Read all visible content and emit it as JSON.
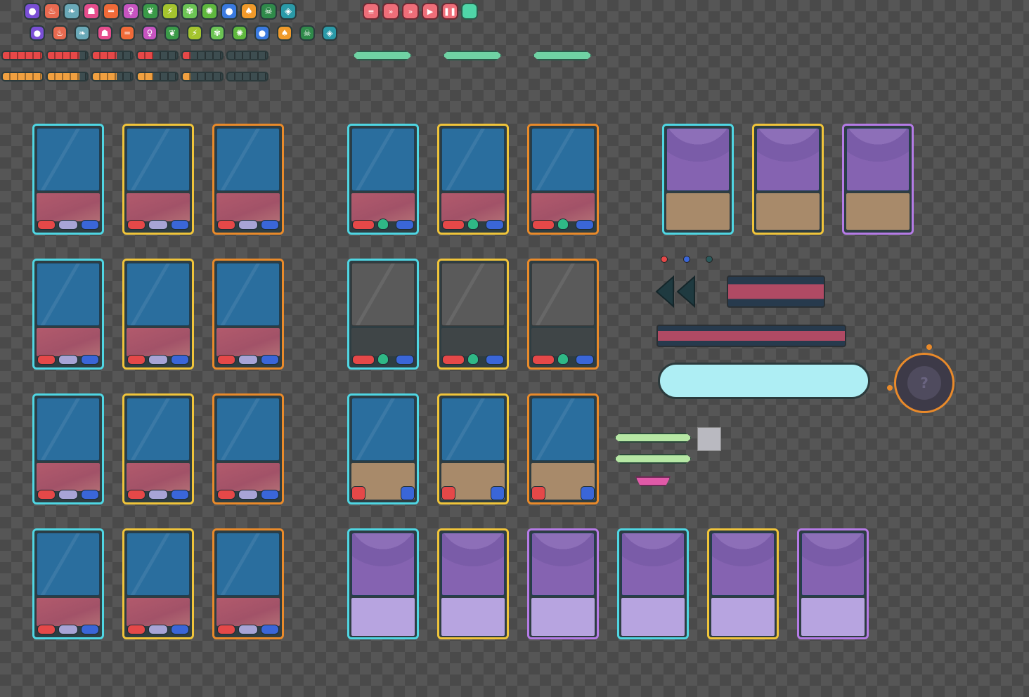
{
  "icons": {
    "row1": [
      {
        "name": "speech-icon",
        "glyph": "●",
        "color": "#7a4fd6"
      },
      {
        "name": "flame-icon",
        "glyph": "♨",
        "color": "#e86a50"
      },
      {
        "name": "feather-icon",
        "glyph": "❧",
        "color": "#6aa9b8"
      },
      {
        "name": "ghost-icon",
        "glyph": "☗",
        "color": "#e64d8c"
      },
      {
        "name": "dumbbell-icon",
        "glyph": "═",
        "color": "#f06a38"
      },
      {
        "name": "fairy-icon",
        "glyph": "♀",
        "color": "#c754c0"
      },
      {
        "name": "leaf-icon",
        "glyph": "❦",
        "color": "#3a9a48"
      },
      {
        "name": "lightning-icon",
        "glyph": "⚡",
        "color": "#a4c42e"
      },
      {
        "name": "butterfly-icon",
        "glyph": "✾",
        "color": "#6cc454"
      },
      {
        "name": "bug-icon",
        "glyph": "✺",
        "color": "#5fb83e"
      },
      {
        "name": "water-drop-icon",
        "glyph": "●",
        "color": "#3a7ae0"
      },
      {
        "name": "fire-icon",
        "glyph": "♠",
        "color": "#f09a2a"
      },
      {
        "name": "skull-icon",
        "glyph": "☠",
        "color": "#2f8a4a"
      },
      {
        "name": "target-icon",
        "glyph": "◈",
        "color": "#2a9aa8"
      }
    ],
    "controls": [
      {
        "name": "list-icon",
        "glyph": "≡"
      },
      {
        "name": "fast-forward-3-icon",
        "glyph": "»"
      },
      {
        "name": "fast-forward-icon",
        "glyph": "»"
      },
      {
        "name": "play-icon",
        "glyph": "▶"
      },
      {
        "name": "pause-icon",
        "glyph": "❚❚"
      },
      {
        "name": "blank-icon",
        "glyph": ""
      }
    ]
  },
  "bars": {
    "red_fill": [
      1.0,
      0.8,
      0.6,
      0.4,
      0.2,
      0.0
    ],
    "orange_fill": [
      1.0,
      0.8,
      0.6,
      0.4,
      0.2,
      0.0
    ],
    "red_color": "#e64848",
    "orange_color": "#f0a040"
  },
  "colors": {
    "accent_cyan": "#4fd6e3",
    "accent_gold": "#f0c43a",
    "accent_orange": "#e98a2a",
    "accent_violet": "#b57be6",
    "dot_red": "#e64848",
    "dot_blue": "#3a66d8",
    "dot_teal": "#2a5a5c"
  },
  "help_dial": {
    "glyph": "?"
  }
}
